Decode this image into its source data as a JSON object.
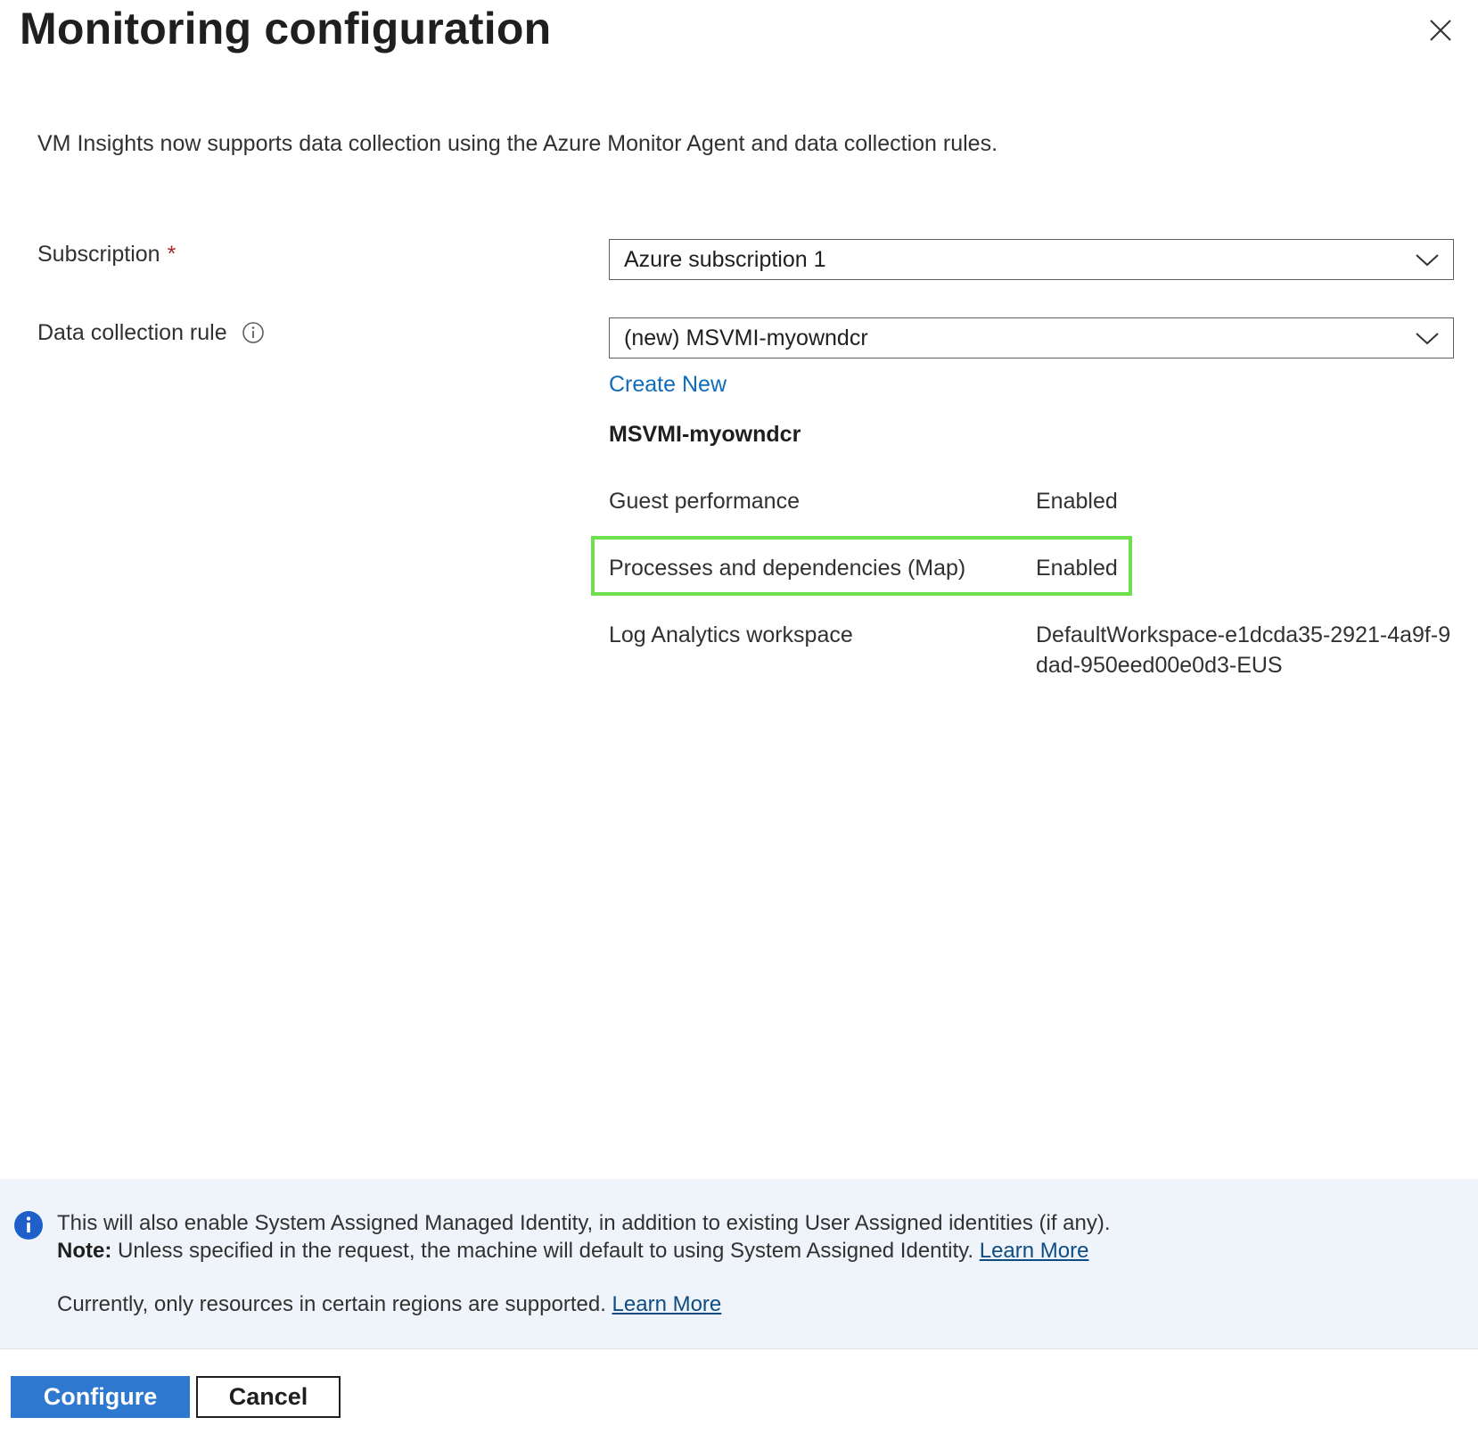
{
  "panel": {
    "title": "Monitoring configuration",
    "intro": "VM Insights now supports data collection using the Azure Monitor Agent and data collection rules."
  },
  "form": {
    "subscription": {
      "label": "Subscription",
      "required_mark": "*",
      "selected": "Azure subscription 1"
    },
    "data_collection_rule": {
      "label": "Data collection rule",
      "selected": "(new) MSVMI-myowndcr",
      "create_new_label": "Create New"
    }
  },
  "dcr_details": {
    "name": "MSVMI-myowndcr",
    "rows": [
      {
        "label": "Guest performance",
        "value": "Enabled"
      },
      {
        "label": "Processes and dependencies (Map)",
        "value": "Enabled"
      },
      {
        "label": "Log Analytics workspace",
        "value": "DefaultWorkspace-e1dcda35-2921-4a9f-9dad-950eed00e0d3-EUS"
      }
    ]
  },
  "notice": {
    "line1": "This will also enable System Assigned Managed Identity, in addition to existing User Assigned identities (if any).",
    "note_label": "Note:",
    "line2": " Unless specified in the request, the machine will default to using System Assigned Identity. ",
    "line2_link": "Learn More",
    "line3": "Currently, only resources in certain regions are supported. ",
    "line3_link": "Learn More"
  },
  "footer": {
    "configure_label": "Configure",
    "cancel_label": "Cancel"
  },
  "colors": {
    "accent": "#2f78d0",
    "link": "#0f6cbd",
    "highlight": "#6ee04b",
    "required": "#a4262c",
    "notice_bg": "#eff4fb"
  },
  "icons": {
    "close": "close-icon",
    "info": "info-icon",
    "chevron": "chevron-down-icon",
    "notice": "info-filled-icon"
  }
}
